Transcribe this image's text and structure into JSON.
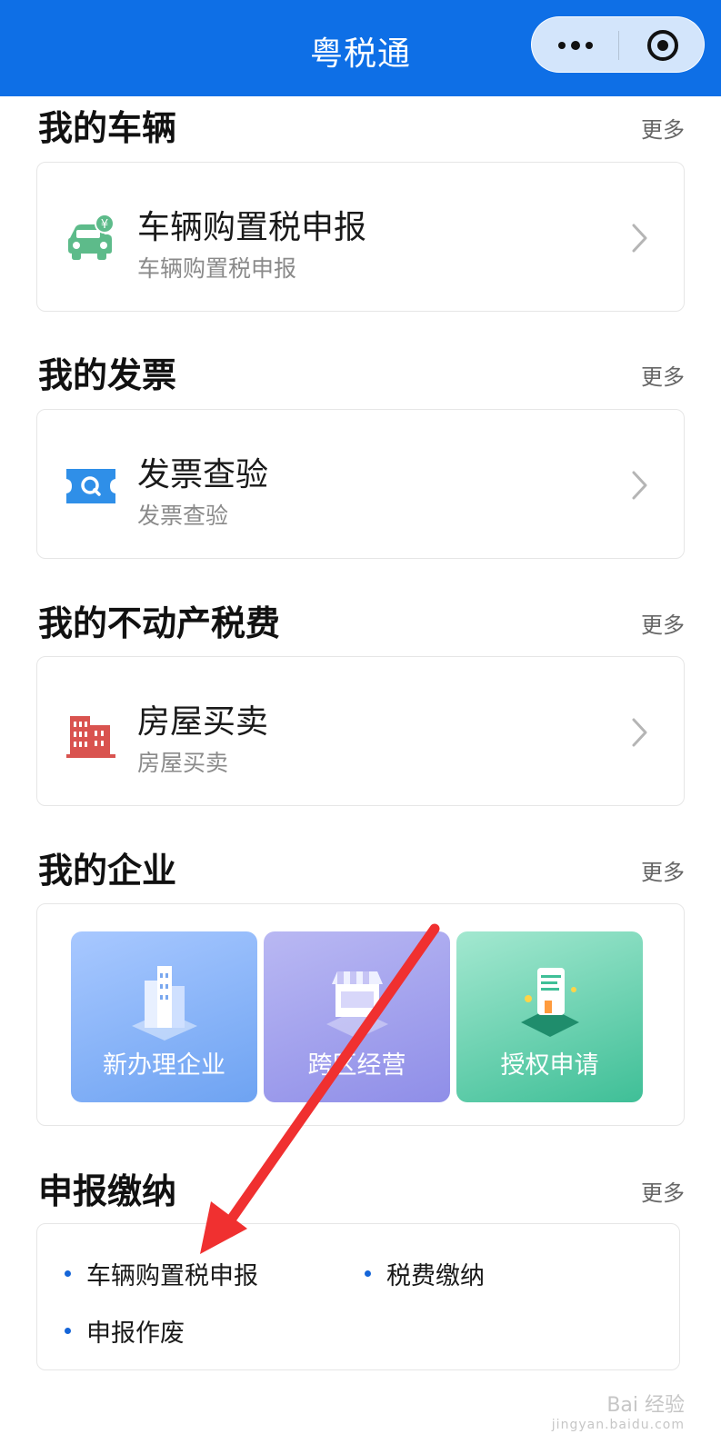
{
  "header": {
    "title": "粤税通",
    "more_icon": "more-dots-icon",
    "close_icon": "target-close-icon"
  },
  "sections": {
    "vehicle": {
      "title": "我的车辆",
      "more": "更多",
      "item": {
        "title": "车辆购置税申报",
        "subtitle": "车辆购置税申报",
        "icon": "car-yuan-icon",
        "icon_color": "#5dbb8a"
      }
    },
    "invoice": {
      "title": "我的发票",
      "more": "更多",
      "item": {
        "title": "发票查验",
        "subtitle": "发票查验",
        "icon": "ticket-search-icon",
        "icon_color": "#2f8fe8"
      }
    },
    "property": {
      "title": "我的不动产税费",
      "more": "更多",
      "item": {
        "title": "房屋买卖",
        "subtitle": "房屋买卖",
        "icon": "building-icon",
        "icon_color": "#d9534f"
      }
    },
    "enterprise": {
      "title": "我的企业",
      "more": "更多",
      "tiles": [
        {
          "label": "新办理企业",
          "icon": "city-buildings-icon",
          "color_from": "#a8c8ff",
          "color_to": "#6ea3f2"
        },
        {
          "label": "跨区经营",
          "icon": "storefront-icon",
          "color_from": "#b9b8f3",
          "color_to": "#8f8ee8"
        },
        {
          "label": "授权申请",
          "icon": "phone-document-icon",
          "color_from": "#a3e8d0",
          "color_to": "#3fbf97"
        }
      ]
    },
    "declare": {
      "title": "申报缴纳",
      "more": "更多",
      "items": [
        "车辆购置税申报",
        "税费缴纳",
        "申报作废"
      ]
    }
  },
  "watermark": {
    "text": "Bai 经验",
    "sub": "jingyan.baidu.com"
  },
  "annotation": {
    "arrow_color": "#f03030"
  }
}
